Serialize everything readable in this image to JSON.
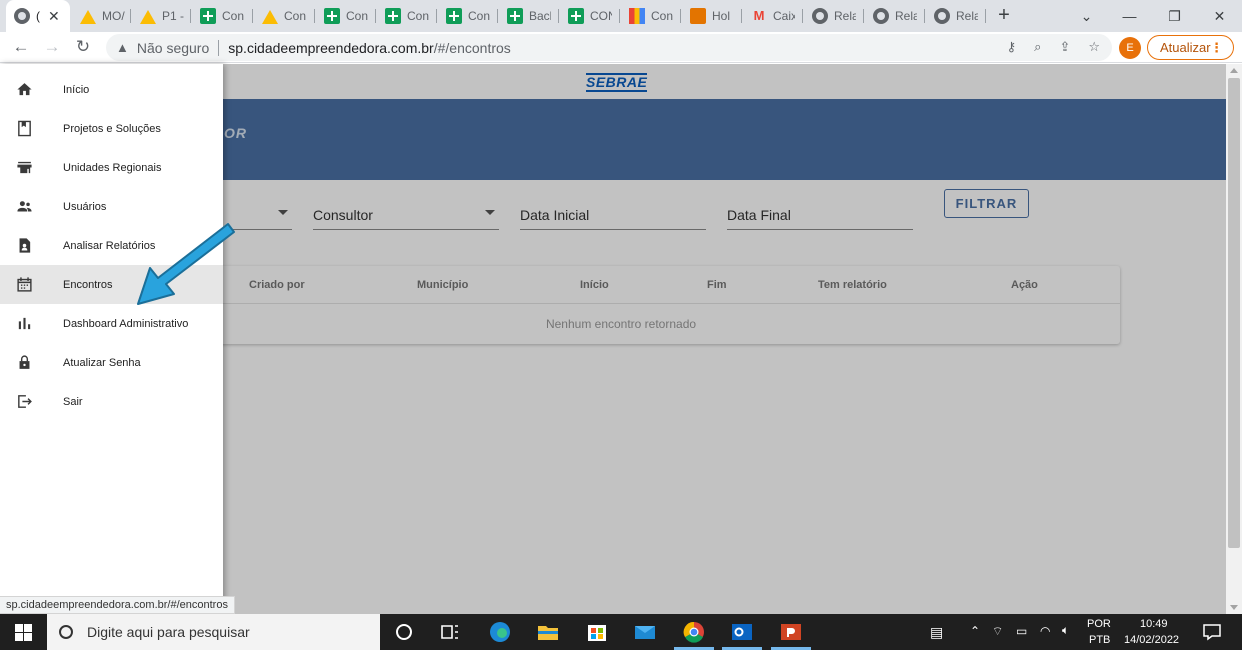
{
  "browser": {
    "tabs": [
      {
        "label": "(",
        "icon": "globe-icon",
        "active": true
      },
      {
        "label": "MO/",
        "icon": "drive-icon"
      },
      {
        "label": "P1 -",
        "icon": "drive-icon"
      },
      {
        "label": "Con",
        "icon": "sheets-icon"
      },
      {
        "label": "Con",
        "icon": "drive-icon"
      },
      {
        "label": "Con",
        "icon": "sheets-icon"
      },
      {
        "label": "Con",
        "icon": "sheets-icon"
      },
      {
        "label": "Con",
        "icon": "sheets-icon"
      },
      {
        "label": "Back",
        "icon": "sheets-icon"
      },
      {
        "label": "CON",
        "icon": "sheets-icon"
      },
      {
        "label": "Con",
        "icon": "grid-icon"
      },
      {
        "label": "Hol",
        "icon": "photo-icon"
      },
      {
        "label": "Caix",
        "icon": "gmail-icon"
      },
      {
        "label": "Rela",
        "icon": "globe-icon"
      },
      {
        "label": "Rela",
        "icon": "globe-icon"
      },
      {
        "label": "Rela",
        "icon": "globe-icon"
      }
    ],
    "security_label": "Não seguro",
    "url_host": "sp.cidadeempreendedora.com.br",
    "url_rest": "/#/encontros",
    "profile_initial": "E",
    "update_label": "Atualizar",
    "status_url": "sp.cidadeempreendedora.com.br/#/encontros"
  },
  "page": {
    "logo": "SEBRAE",
    "hero_title_fragment": "OR",
    "filters": {
      "consultor_label": "Consultor",
      "data_inicial_label": "Data Inicial",
      "data_final_label": "Data Final",
      "filter_button": "FILTRAR"
    },
    "table": {
      "headers": [
        "Criado por",
        "Município",
        "Início",
        "Fim",
        "Tem relatório",
        "Ação"
      ],
      "empty_message": "Nenhum encontro retornado"
    }
  },
  "sidebar": {
    "items": [
      {
        "label": "Início",
        "icon": "home-icon"
      },
      {
        "label": "Projetos e Soluções",
        "icon": "bookmark-icon"
      },
      {
        "label": "Unidades Regionais",
        "icon": "store-icon"
      },
      {
        "label": "Usuários",
        "icon": "people-icon"
      },
      {
        "label": "Analisar Relatórios",
        "icon": "report-icon"
      },
      {
        "label": "Encontros",
        "icon": "calendar-icon",
        "active": true
      },
      {
        "label": "Dashboard Administrativo",
        "icon": "bar-chart-icon"
      },
      {
        "label": "Atualizar Senha",
        "icon": "lock-icon"
      },
      {
        "label": "Sair",
        "icon": "exit-icon"
      }
    ]
  },
  "taskbar": {
    "search_placeholder": "Digite aqui para pesquisar",
    "language": "POR",
    "layout": "PTB",
    "time": "10:49",
    "date": "14/02/2022"
  },
  "colors": {
    "hero": "#4a70a5",
    "accent": "#4a70a5",
    "annotation_arrow": "#29a3dd",
    "update_orange": "#e8710a"
  }
}
